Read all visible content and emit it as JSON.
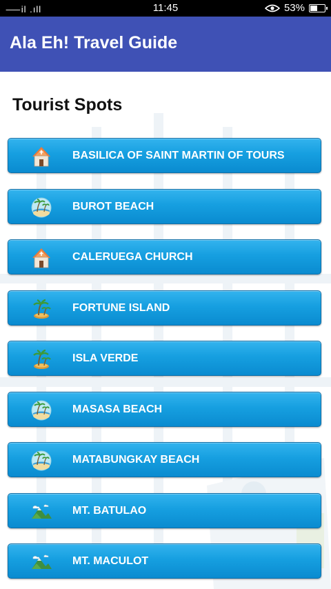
{
  "status_bar": {
    "signal": "⸺il .ıll",
    "time": "11:45",
    "battery": "53%",
    "battery_level": 0.53
  },
  "app_bar": {
    "title": "Ala Eh! Travel Guide"
  },
  "section_title": "Tourist Spots",
  "spots": [
    {
      "label": "BASILICA OF SAINT MARTIN OF TOURS",
      "icon": "church-icon"
    },
    {
      "label": " BUROT BEACH",
      "icon": "beach-globe-icon"
    },
    {
      "label": "CALERUEGA CHURCH",
      "icon": "church-icon"
    },
    {
      "label": "FORTUNE ISLAND",
      "icon": "palm-island-icon"
    },
    {
      "label": "ISLA VERDE",
      "icon": "palm-island-icon"
    },
    {
      "label": "MASASA BEACH",
      "icon": "beach-globe-icon"
    },
    {
      "label": "MATABUNGKAY BEACH",
      "icon": "beach-globe-icon"
    },
    {
      "label": "MT. BATULAO",
      "icon": "mountain-icon"
    },
    {
      "label": "MT. MACULOT",
      "icon": "mountain-icon"
    }
  ],
  "colors": {
    "app_bar": "#3f51b5",
    "button": "#169fe0"
  }
}
